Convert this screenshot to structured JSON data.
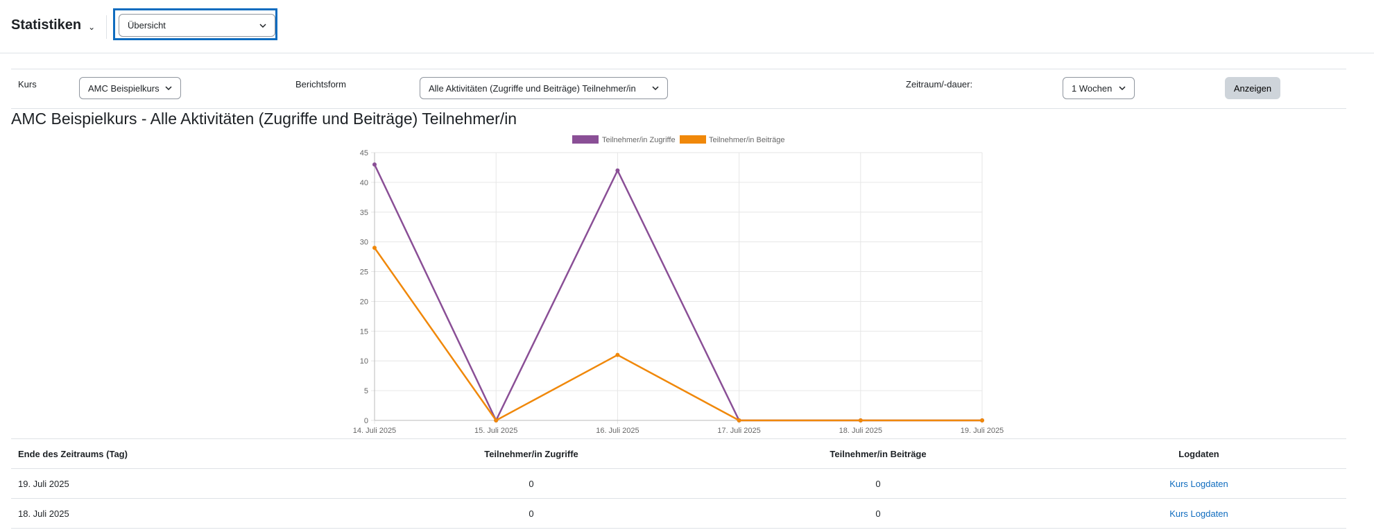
{
  "header": {
    "title": "Statistiken",
    "view_select": "Übersicht"
  },
  "form": {
    "course_label": "Kurs",
    "course_value": "AMC Beispielkurs",
    "report_label": "Berichtsform",
    "report_value": "Alle Aktivitäten (Zugriffe und Beiträge) Teilnehmer/in",
    "period_label": "Zeitraum/-dauer:",
    "period_value": "1 Wochen",
    "submit_label": "Anzeigen"
  },
  "report_title": "AMC Beispielkurs - Alle Aktivitäten (Zugriffe und Beiträge) Teilnehmer/in",
  "chart_data": {
    "type": "line",
    "title": "",
    "xlabel": "",
    "ylabel": "",
    "x": [
      "14. Juli 2025",
      "15. Juli 2025",
      "16. Juli 2025",
      "17. Juli 2025",
      "18. Juli 2025",
      "19. Juli 2025"
    ],
    "ylim": [
      0,
      45
    ],
    "yticks": [
      0,
      5,
      10,
      15,
      20,
      25,
      30,
      35,
      40,
      45
    ],
    "grid": true,
    "legend_position": "top",
    "series": [
      {
        "name": "Teilnehmer/in Zugriffe",
        "color": "#8a4f96",
        "values": [
          43,
          0,
          42,
          0,
          0,
          0
        ]
      },
      {
        "name": "Teilnehmer/in Beiträge",
        "color": "#f0880a",
        "values": [
          29,
          0,
          11,
          0,
          0,
          0
        ]
      }
    ]
  },
  "table": {
    "headers": [
      "Ende des Zeitraums (Tag)",
      "Teilnehmer/in Zugriffe",
      "Teilnehmer/in Beiträge",
      "Logdaten"
    ],
    "rows": [
      {
        "date": "19. Juli 2025",
        "views": "0",
        "posts": "0",
        "link": "Kurs Logdaten"
      },
      {
        "date": "18. Juli 2025",
        "views": "0",
        "posts": "0",
        "link": "Kurs Logdaten"
      }
    ]
  }
}
